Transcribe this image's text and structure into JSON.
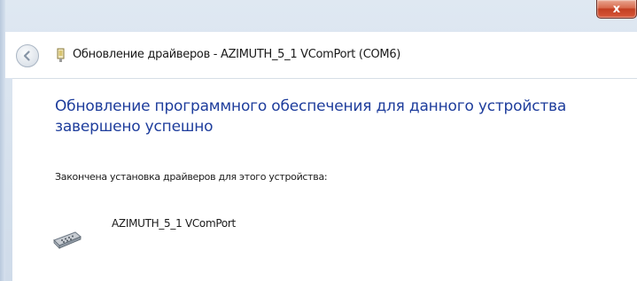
{
  "window": {
    "title": "Обновление драйверов - AZIMUTH_5_1 VComPort (COM6)",
    "close_label": "x"
  },
  "content": {
    "heading": "Обновление программного обеспечения для данного устройства завершено успешно",
    "status": "Закончена установка драйверов для этого устройства:",
    "device_name": "AZIMUTH_5_1 VComPort"
  },
  "icons": {
    "back": "back-arrow-icon",
    "title_device": "device-icon",
    "device": "serial-port-icon"
  },
  "colors": {
    "heading": "#1e3d9c",
    "close_button": "#c23f22",
    "frame": "#d6e1ee"
  }
}
